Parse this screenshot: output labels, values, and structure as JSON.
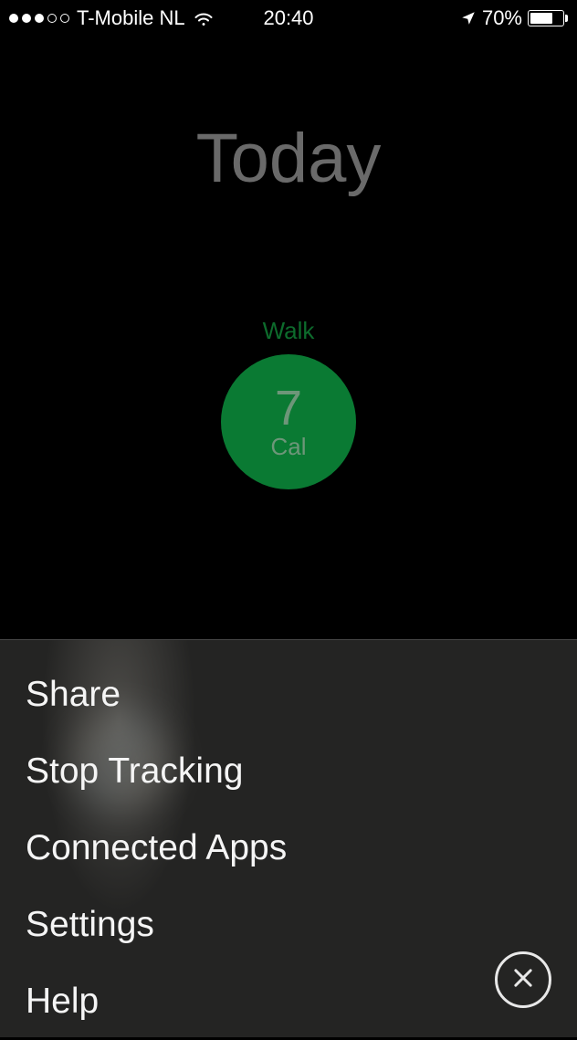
{
  "status_bar": {
    "carrier": "T-Mobile NL",
    "time": "20:40",
    "battery_percent": "70%"
  },
  "header": {
    "title": "Today"
  },
  "activity": {
    "label": "Walk",
    "value": "7",
    "unit": "Cal"
  },
  "menu": {
    "items": [
      {
        "label": "Share"
      },
      {
        "label": "Stop Tracking"
      },
      {
        "label": "Connected Apps"
      },
      {
        "label": "Settings"
      },
      {
        "label": "Help"
      }
    ]
  },
  "colors": {
    "activity_green": "#0a7a33",
    "title_gray": "#6a6a6a"
  }
}
